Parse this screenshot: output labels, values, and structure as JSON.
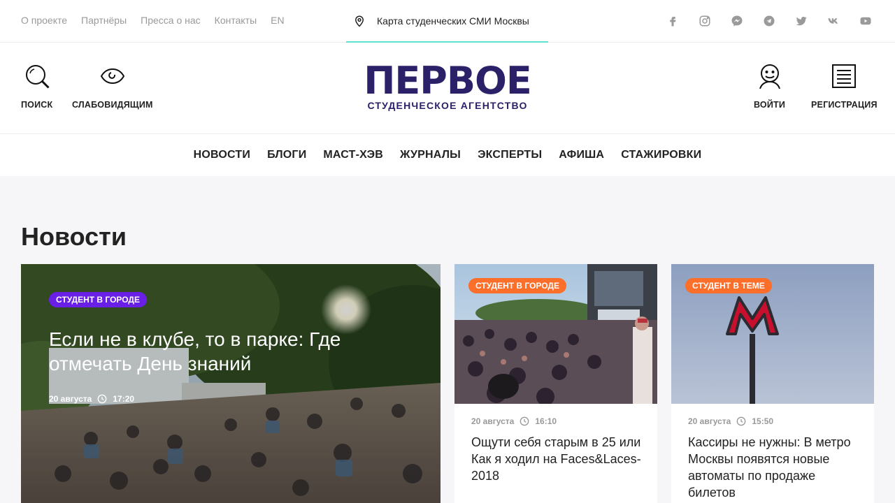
{
  "topbar": {
    "links": [
      "О проекте",
      "Партнёры",
      "Пресса о нас",
      "Контакты",
      "EN"
    ],
    "map_link": "Карта студенческих СМИ Москвы",
    "social": [
      "facebook-icon",
      "instagram-icon",
      "messenger-icon",
      "telegram-icon",
      "twitter-icon",
      "vk-icon",
      "youtube-icon"
    ]
  },
  "header": {
    "search_label": "ПОИСК",
    "low_vision_label": "СЛАБОВИДЯЩИМ",
    "logo_main": "ПЕРВОЕ",
    "logo_sub": "СТУДЕНЧЕСКОЕ АГЕНТСТВО",
    "login_label": "ВОЙТИ",
    "register_label": "РЕГИСТРАЦИЯ"
  },
  "nav": [
    "НОВОСТИ",
    "БЛОГИ",
    "МАСТ-ХЭВ",
    "ЖУРНАЛЫ",
    "ЭКСПЕРТЫ",
    "АФИША",
    "СТАЖИРОВКИ"
  ],
  "section_title": "Новости",
  "hero": {
    "tag": "СТУДЕНТ В ГОРОДЕ",
    "title": "Если не в клубе, то в парке: Где отмечать День знаний",
    "date": "20 августа",
    "time": "17:20"
  },
  "cards": [
    {
      "tag": "СТУДЕНТ В ГОРОДЕ",
      "date": "20 августа",
      "time": "16:10",
      "title": "Ощути себя старым в 25 или Как я ходил на Faces&Laces-2018"
    },
    {
      "tag": "СТУДЕНТ В ТЕМЕ",
      "date": "20 августа",
      "time": "15:50",
      "title": "Кассиры не нужны: В метро Москвы появятся новые автоматы по продаже билетов"
    }
  ],
  "colors": {
    "brand": "#2b2168",
    "accent_teal": "#5fe3cf",
    "tag_purple": "#6a1fe6",
    "tag_orange": "#fb6f2a"
  }
}
